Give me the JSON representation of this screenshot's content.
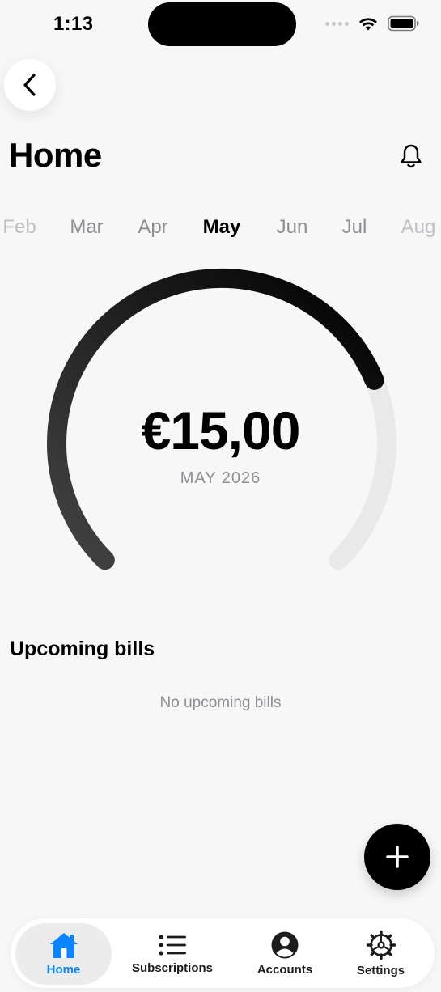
{
  "status_bar": {
    "time": "1:13"
  },
  "header": {
    "title": "Home"
  },
  "months": {
    "items": [
      "Feb",
      "Mar",
      "Apr",
      "May",
      "Jun",
      "Jul",
      "Aug"
    ],
    "selected": "May"
  },
  "summary": {
    "amount": "€15,00",
    "period": "MAY 2026",
    "gauge_fill_fraction": 0.75
  },
  "upcoming": {
    "title": "Upcoming bills",
    "empty_text": "No upcoming bills"
  },
  "tabs": [
    {
      "label": "Home",
      "icon": "house-icon",
      "active": true
    },
    {
      "label": "Subscriptions",
      "icon": "list-icon",
      "active": false
    },
    {
      "label": "Accounts",
      "icon": "person-circle-icon",
      "active": false
    },
    {
      "label": "Settings",
      "icon": "gear-icon",
      "active": false
    }
  ],
  "colors": {
    "accent": "#0a84ff",
    "background": "#f7f7f7",
    "gauge_track": "#e9e9e9",
    "gauge_fill_start": "#444444",
    "gauge_fill_end": "#000000"
  }
}
